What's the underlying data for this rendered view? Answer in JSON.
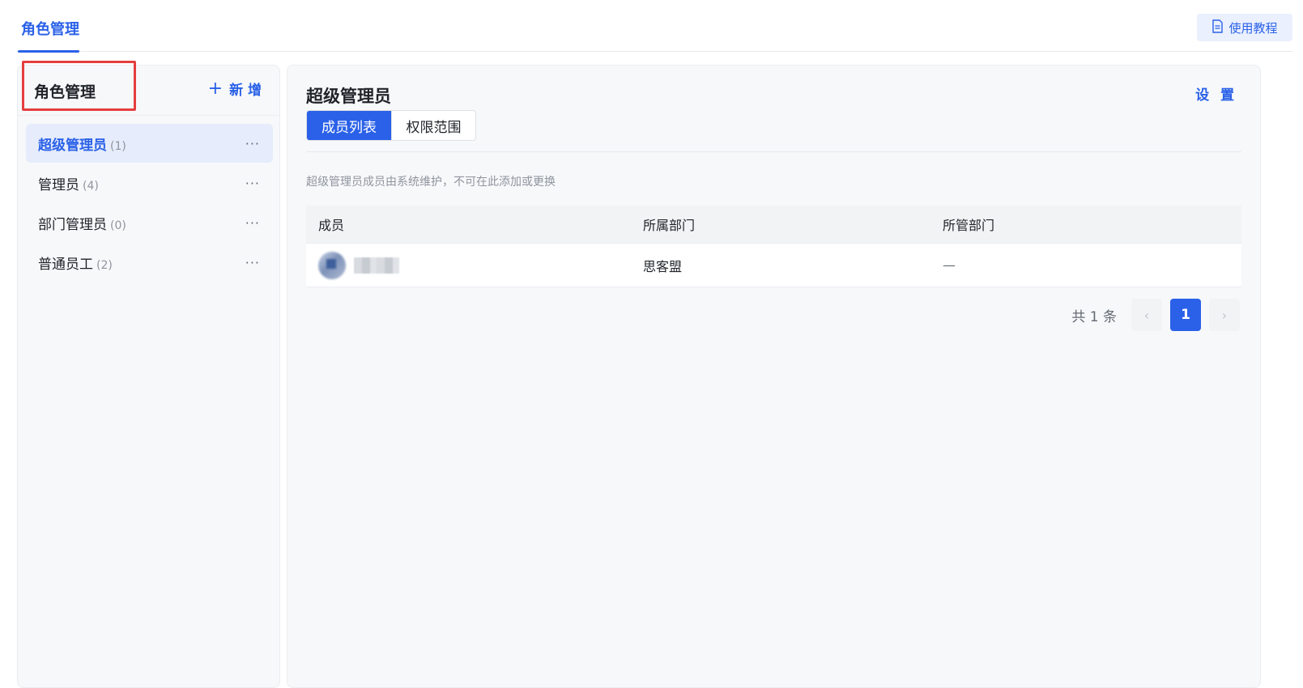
{
  "top": {
    "tab_label": "角色管理",
    "tutorial_label": "使用教程",
    "tutorial_icon": "document-icon"
  },
  "left": {
    "title": "角色管理",
    "add_label": "新 增",
    "add_icon": "plus",
    "roles": [
      {
        "name": "超级管理员",
        "count": "(1)",
        "active": true
      },
      {
        "name": "管理员",
        "count": "(4)",
        "active": false
      },
      {
        "name": "部门管理员",
        "count": "(0)",
        "active": false
      },
      {
        "name": "普通员工",
        "count": "(2)",
        "active": false
      }
    ],
    "more_glyph": "···"
  },
  "right": {
    "role_title": "超级管理员",
    "settings_label": "设 置",
    "tabs": [
      "成员列表",
      "权限范围"
    ],
    "active_tab": "成员列表",
    "notice": "超级管理员成员由系统维护，不可在此添加或更换",
    "table": {
      "headers": [
        "成员",
        "所属部门",
        "所管部门"
      ],
      "rows": [
        {
          "department": "思客盟",
          "managed": "—"
        }
      ]
    },
    "pagination": {
      "total": "共 1 条",
      "prev": "‹",
      "current": "1",
      "next": "›"
    }
  },
  "colors": {
    "accent": "#2a61e8",
    "highlight_border": "#e53e3e"
  }
}
